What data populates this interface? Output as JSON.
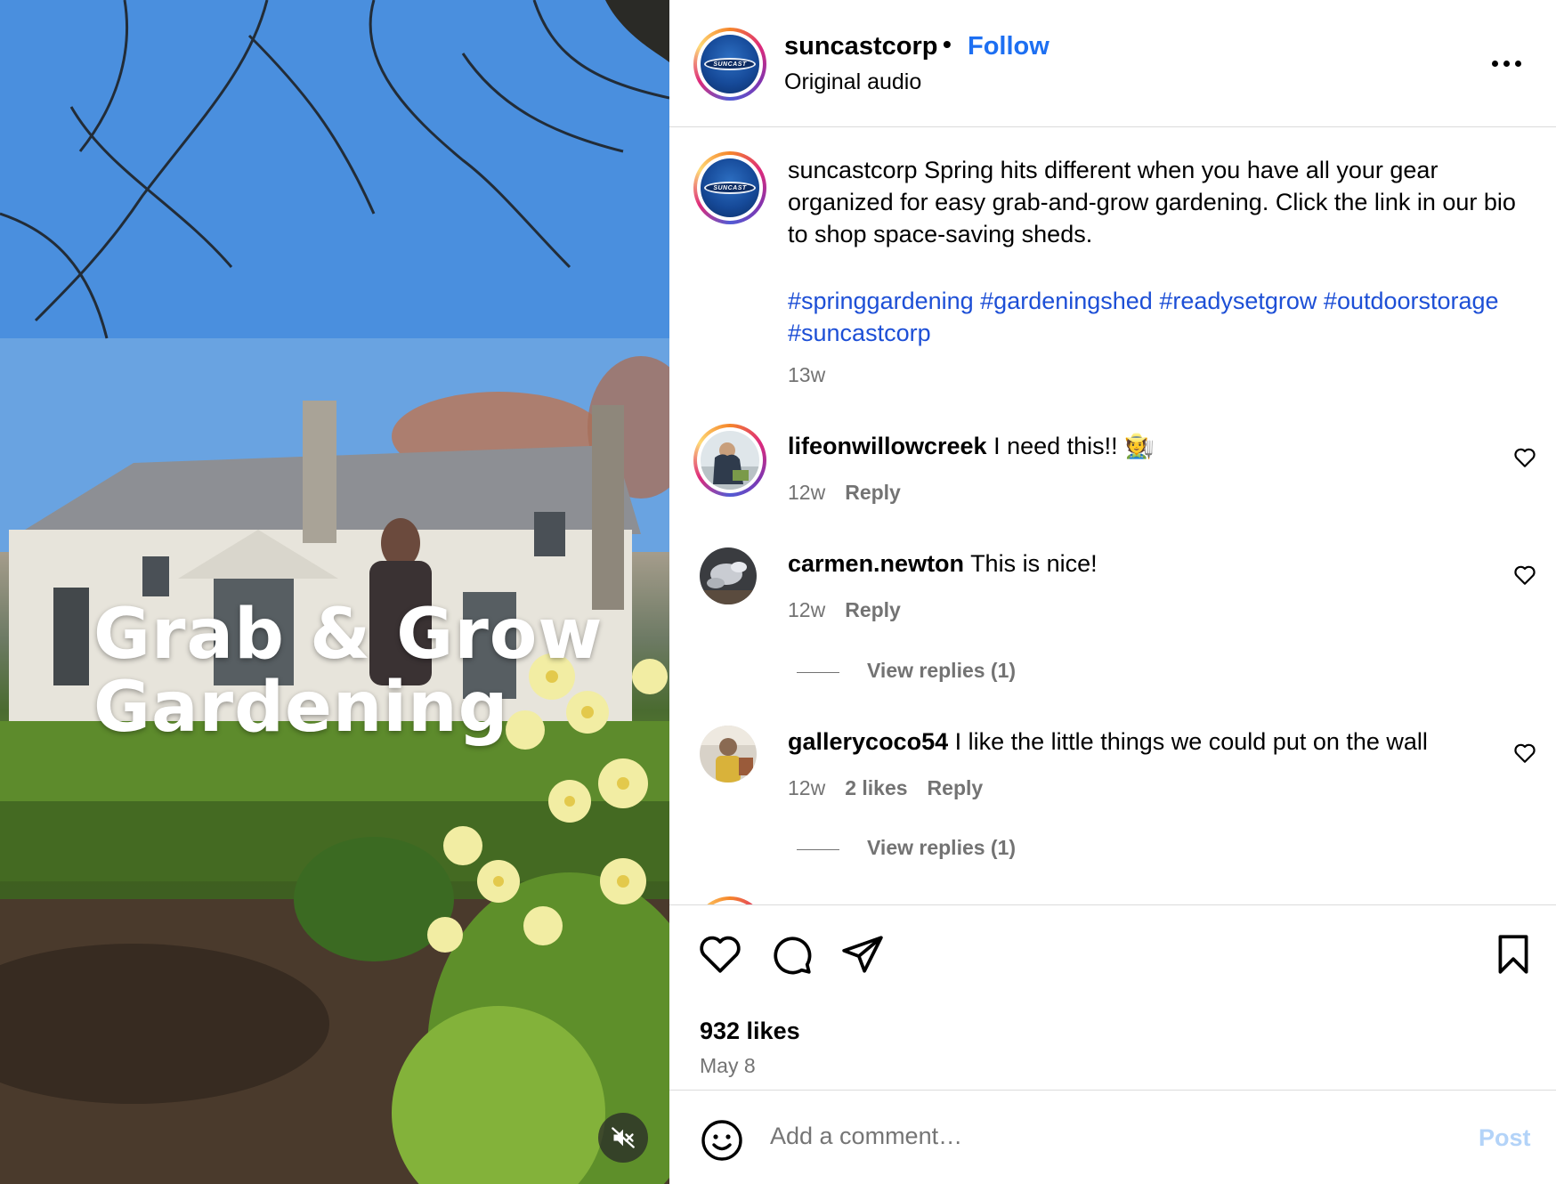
{
  "media": {
    "overlay_line1": "Grab & Grow",
    "overlay_line2": "Gardening",
    "mute_icon": "speaker-muted-icon"
  },
  "header": {
    "username": "suncastcorp",
    "separator": "•",
    "follow_label": "Follow",
    "audio_label": "Original audio",
    "logo_text": "SUNCAST",
    "more_icon": "more-options-icon"
  },
  "caption": {
    "username": "suncastcorp",
    "text": "Spring hits different when you have all your gear organized for easy grab-and-grow gardening. Click the link in our bio to shop space-saving sheds.",
    "hashtags": "#springgardening #gardeningshed #readysetgrow #outdoorstorage #suncastcorp",
    "time": "13w"
  },
  "comments": [
    {
      "username": "lifeonwillowcreek",
      "text": "I need this!! 🧑‍🌾",
      "time": "12w",
      "likes": "",
      "reply_label": "Reply",
      "view_replies": ""
    },
    {
      "username": "carmen.newton",
      "text": "This is nice!",
      "time": "12w",
      "likes": "",
      "reply_label": "Reply",
      "view_replies": "View replies (1)"
    },
    {
      "username": "gallerycoco54",
      "text": "I like the little things we could put on the wall",
      "time": "12w",
      "likes": "2 likes",
      "reply_label": "Reply",
      "view_replies": "View replies (1)"
    }
  ],
  "actions": {
    "icons": [
      "heart-icon",
      "comment-icon",
      "share-icon",
      "bookmark-icon"
    ],
    "likes": "932 likes",
    "date": "May 8"
  },
  "add_comment": {
    "placeholder": "Add a comment…",
    "post_label": "Post",
    "emoji_icon": "emoji-icon"
  },
  "colors": {
    "link_blue": "#1d4fd6",
    "follow_blue": "#1d6ff2",
    "muted_gray": "#737373",
    "post_disabled": "#b3d3f8"
  }
}
